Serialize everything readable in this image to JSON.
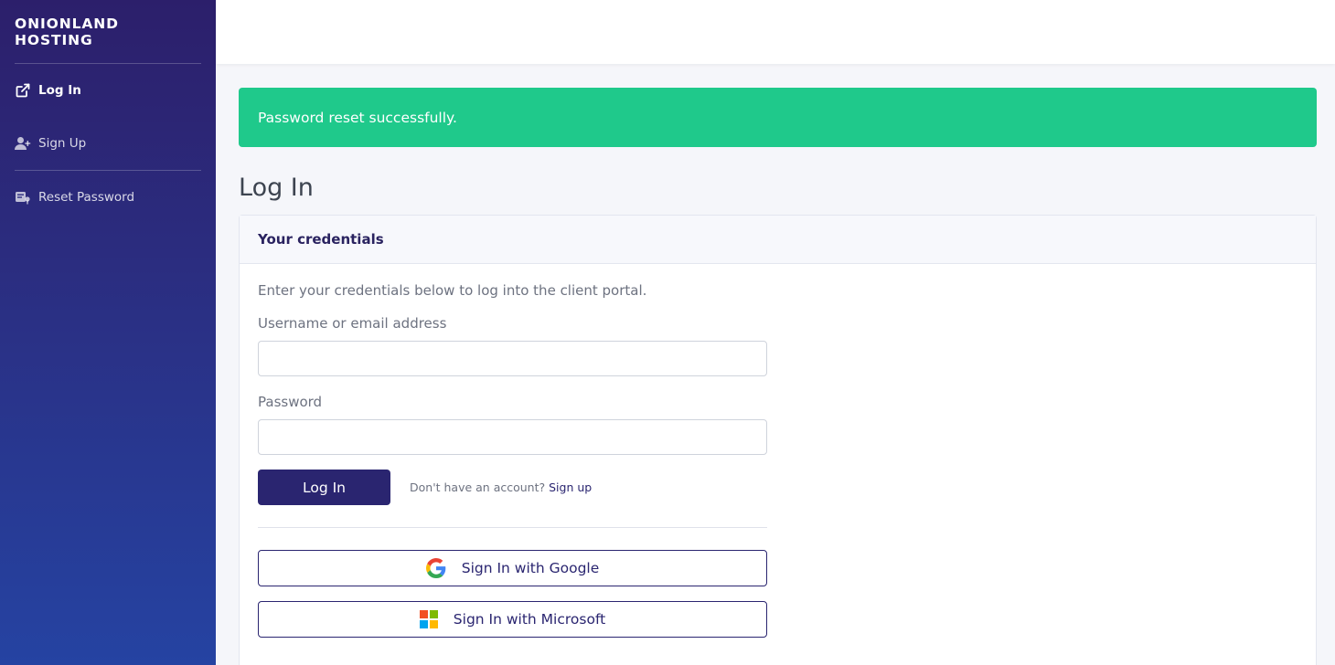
{
  "sidebar": {
    "brand": "ONIONLAND HOSTING",
    "items": [
      {
        "label": "Log In",
        "icon": "external-link-icon",
        "active": true
      },
      {
        "label": "Sign Up",
        "icon": "user-plus-icon",
        "active": false
      },
      {
        "label": "Reset Password",
        "icon": "key-reset-icon",
        "active": false
      }
    ]
  },
  "alert": {
    "message": "Password reset successfully.",
    "color": "#1fc98b"
  },
  "page": {
    "title": "Log In"
  },
  "card": {
    "header": "Your credentials",
    "intro": "Enter your credentials below to log into the client portal.",
    "username_label": "Username or email address",
    "username_value": "",
    "password_label": "Password",
    "password_value": "",
    "login_button": "Log In",
    "signup_prompt": "Don't have an account?",
    "signup_link": "Sign up",
    "google_button": "Sign In with Google",
    "microsoft_button": "Sign In with Microsoft"
  },
  "colors": {
    "primary": "#2a2570",
    "sidebar_top": "#2c1f6b",
    "sidebar_bottom": "#2543a2"
  }
}
